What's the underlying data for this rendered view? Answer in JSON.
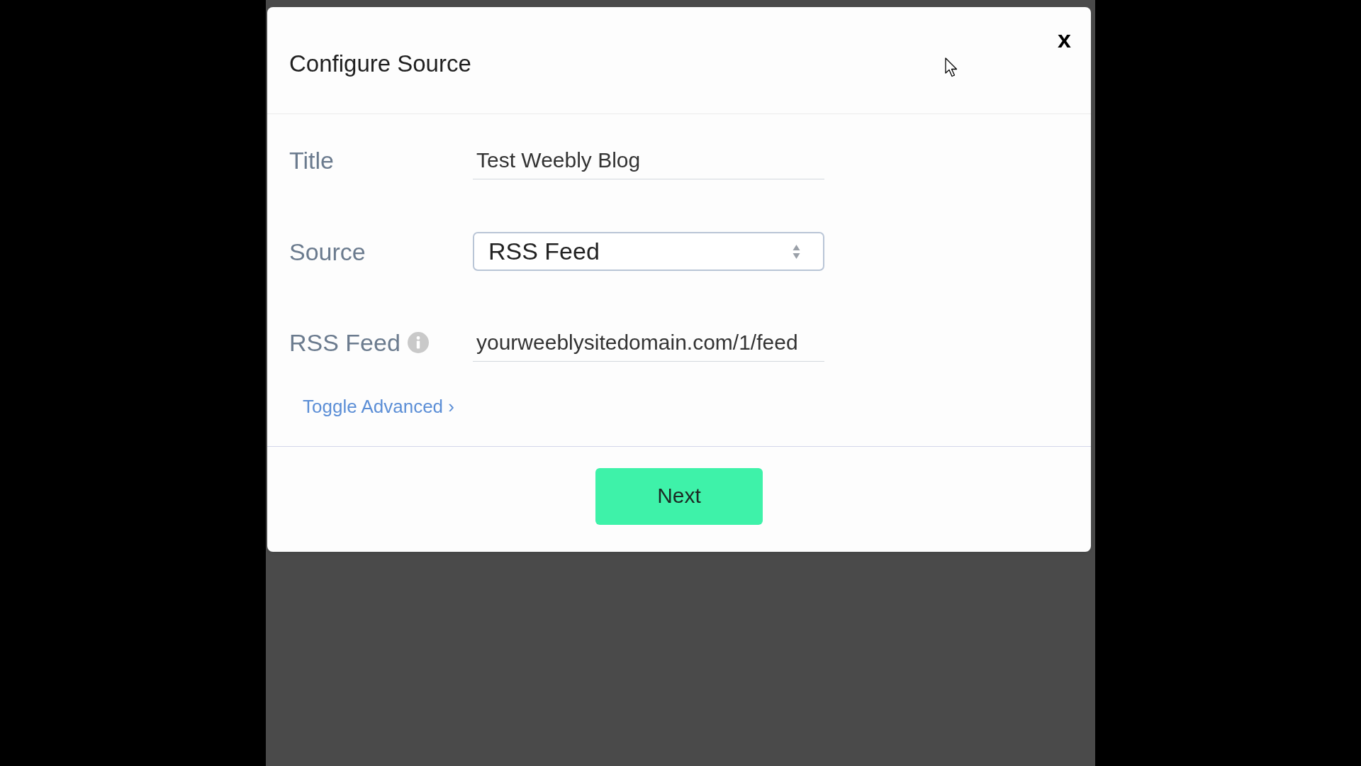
{
  "dialog": {
    "title": "Configure Source",
    "close": "x"
  },
  "fields": [
    {
      "kind": "text",
      "label": "Title",
      "value": "Test Weebly Blog",
      "info": false
    },
    {
      "kind": "select",
      "label": "Source",
      "value": "RSS Feed",
      "info": false
    },
    {
      "kind": "text",
      "label": "RSS Feed",
      "value": "yourweeblysitedomain.com/1/feed",
      "info": true
    }
  ],
  "advanced_link": {
    "label": "Toggle Advanced ›"
  },
  "buttons": [
    {
      "label": "Next"
    }
  ]
}
